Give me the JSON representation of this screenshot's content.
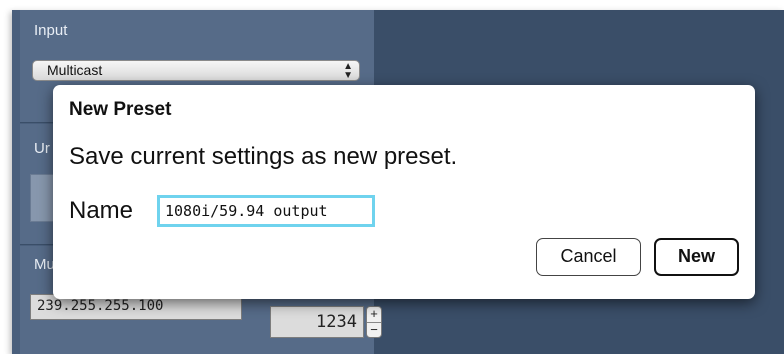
{
  "background": {
    "input_label": "Input",
    "input_select_value": "Multicast",
    "partial_label_1": "Ur",
    "partial_label_2": "Mu",
    "ip_address_value": "239.255.255.100",
    "port_value": "1234",
    "stepper_up": "+",
    "stepper_down": "−"
  },
  "dialog": {
    "title": "New Preset",
    "message": "Save current settings as new preset.",
    "name_label": "Name",
    "name_value": "1080i/59.94 output",
    "cancel_label": "Cancel",
    "new_label": "New"
  },
  "colors": {
    "app_background": "#3a4e68",
    "panel": "#566b88",
    "focus_ring": "#6fd3ee"
  }
}
